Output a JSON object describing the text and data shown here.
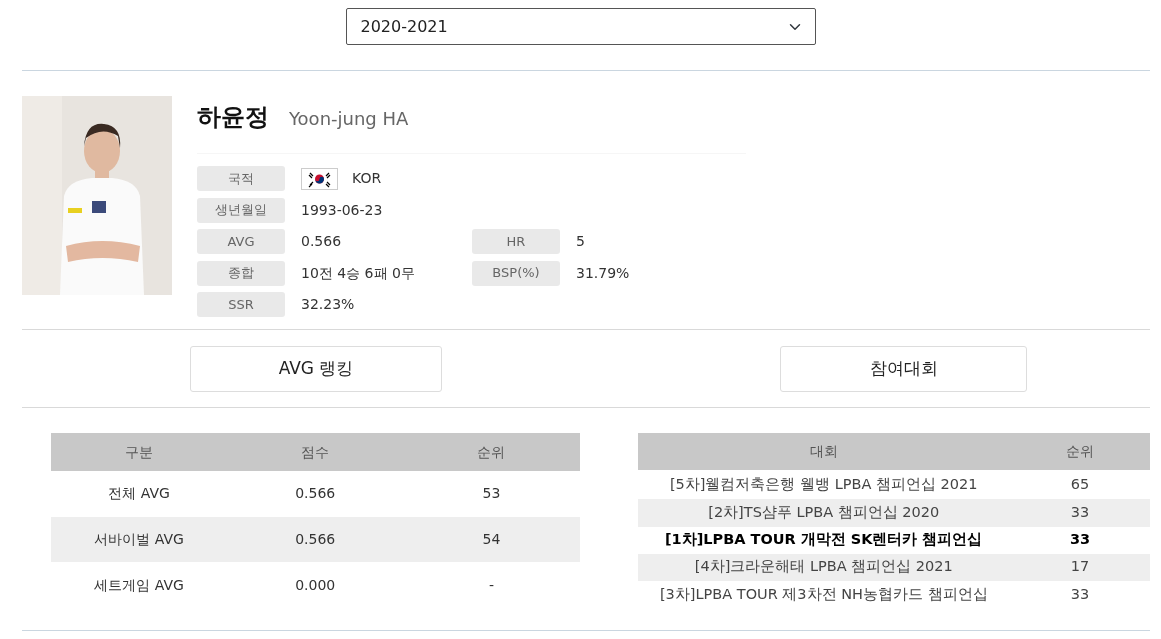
{
  "season_select": {
    "value": "2020-2021"
  },
  "player": {
    "photo": {
      "kind": "picture"
    },
    "name_ko": "하윤정",
    "name_en": "Yoon-jung HA",
    "info_rows": [
      [
        {
          "label": "국적",
          "value": "KOR",
          "kind": "flag"
        }
      ],
      [
        {
          "label": "생년월일",
          "value": "1993-06-23",
          "kind": "text"
        }
      ],
      [
        {
          "label": "AVG",
          "value": "0.566",
          "kind": "text"
        },
        {
          "label": "HR",
          "value": "5",
          "kind": "text"
        }
      ],
      [
        {
          "label": "종합",
          "value": "10전 4승 6패 0무",
          "kind": "text"
        },
        {
          "label": "BSP(%)",
          "value": "31.79%",
          "kind": "text"
        }
      ],
      [
        {
          "label": "SSR",
          "value": "32.23%",
          "kind": "text"
        }
      ]
    ]
  },
  "section_buttons": [
    "AVG 랭킹",
    "참여대회"
  ],
  "avg_table": {
    "columns": [
      "구분",
      "점수",
      "순위"
    ],
    "rows": [
      [
        "전체 AVG",
        "0.566",
        "53"
      ],
      [
        "서바이벌 AVG",
        "0.566",
        "54"
      ],
      [
        "세트게임 AVG",
        "0.000",
        "-"
      ]
    ]
  },
  "tournament_table": {
    "columns": [
      "대회",
      "순위"
    ],
    "rows": [
      {
        "cells": [
          "[5차]웰컴저축은행 웰뱅 LPBA 챔피언십 2021",
          "65"
        ],
        "highlighted": false
      },
      {
        "cells": [
          "[2차]TS샴푸 LPBA 챔피언십 2020",
          "33"
        ],
        "highlighted": false
      },
      {
        "cells": [
          "[1차]LPBA TOUR 개막전 SK렌터카 챔피언십",
          "33"
        ],
        "highlighted": true
      },
      {
        "cells": [
          "[4차]크라운해태 LPBA 챔피언십 2021",
          "17"
        ],
        "highlighted": false
      },
      {
        "cells": [
          "[3차]LPBA TOUR 제3차전 NH농협카드 챔피언십",
          "33"
        ],
        "highlighted": false
      }
    ]
  }
}
